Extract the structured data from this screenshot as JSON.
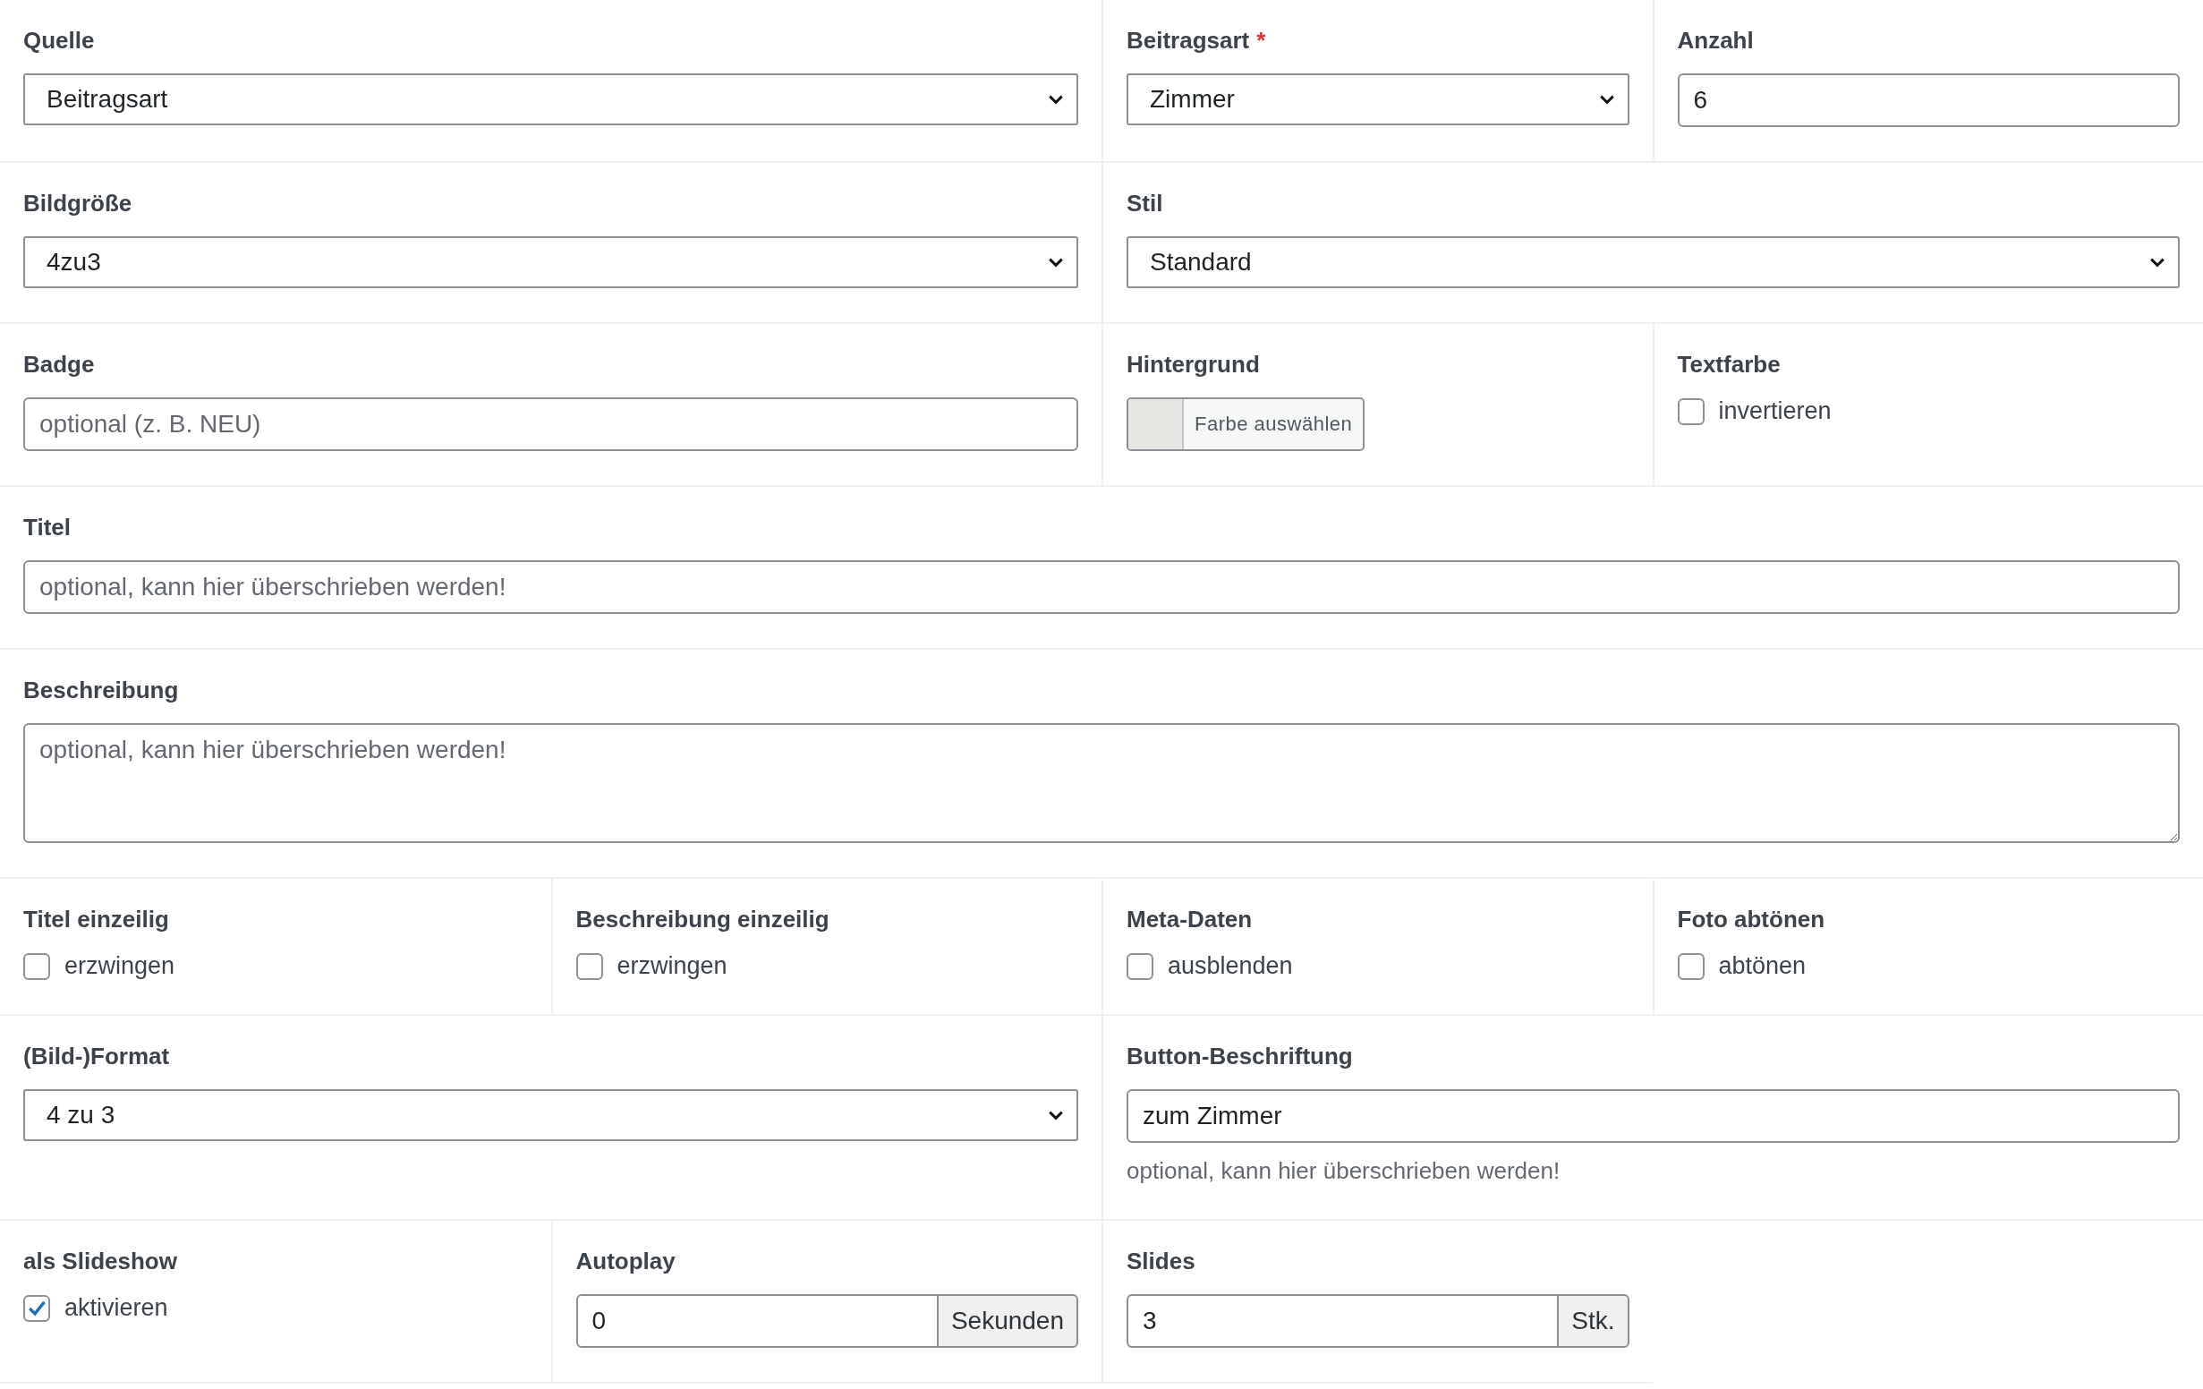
{
  "rows": [
    {
      "fields": [
        {
          "kind": "select",
          "label": "Quelle",
          "wide": true,
          "value": "Beitragsart"
        },
        {
          "kind": "select",
          "label": "Beitragsart",
          "required_mark": "*",
          "wide": false,
          "value": "Zimmer"
        },
        {
          "kind": "input",
          "label": "Anzahl",
          "wide": false,
          "value": "6"
        }
      ]
    },
    {
      "fields": [
        {
          "kind": "select",
          "label": "Bildgröße",
          "wide": true,
          "value": "4zu3"
        },
        {
          "kind": "select",
          "label": "Stil",
          "wide": true,
          "value": "Standard"
        }
      ]
    },
    {
      "fields": [
        {
          "kind": "input",
          "label": "Badge",
          "wide": true,
          "placeholder": "optional (z. B. NEU)"
        },
        {
          "kind": "color",
          "label": "Hintergrund",
          "wide": false,
          "button": "Farbe auswählen",
          "color": "#e8e6e3"
        },
        {
          "kind": "checkbox",
          "label": "Textfarbe",
          "wide": false,
          "option": "invertieren",
          "checked": false
        }
      ]
    },
    {
      "fields": [
        {
          "kind": "input",
          "label": "Titel",
          "placeholder": "optional, kann hier überschrieben werden!"
        }
      ]
    },
    {
      "fields": [
        {
          "kind": "textarea",
          "label": "Beschreibung",
          "placeholder": "optional, kann hier überschrieben werden!"
        }
      ]
    },
    {
      "fields": [
        {
          "kind": "checkbox",
          "label": "Titel einzeilig",
          "wide": false,
          "option": "erzwingen",
          "checked": false
        },
        {
          "kind": "checkbox",
          "label": "Beschreibung einzeilig",
          "wide": false,
          "option": "erzwingen",
          "checked": false
        },
        {
          "kind": "checkbox",
          "label": "Meta-Daten",
          "wide": false,
          "option": "ausblenden",
          "checked": false
        },
        {
          "kind": "checkbox",
          "label": "Foto abtönen",
          "wide": false,
          "option": "abtönen",
          "checked": false
        }
      ]
    },
    {
      "fields": [
        {
          "kind": "select",
          "label": "(Bild-)Format",
          "wide": true,
          "value": "4 zu 3"
        },
        {
          "kind": "input",
          "label": "Button-Beschriftung",
          "wide": true,
          "value": "zum Zimmer",
          "help": "optional, kann hier überschrieben werden!"
        }
      ]
    },
    {
      "fields": [
        {
          "kind": "checkbox",
          "label": "als Slideshow",
          "wide": false,
          "option": "aktivieren",
          "checked": true
        },
        {
          "kind": "addon",
          "label": "Autoplay",
          "wide": false,
          "value": "0",
          "addon": "Sekunden"
        },
        {
          "kind": "addon",
          "label": "Slides",
          "wide": false,
          "value": "3",
          "addon": "Stk."
        }
      ]
    }
  ]
}
